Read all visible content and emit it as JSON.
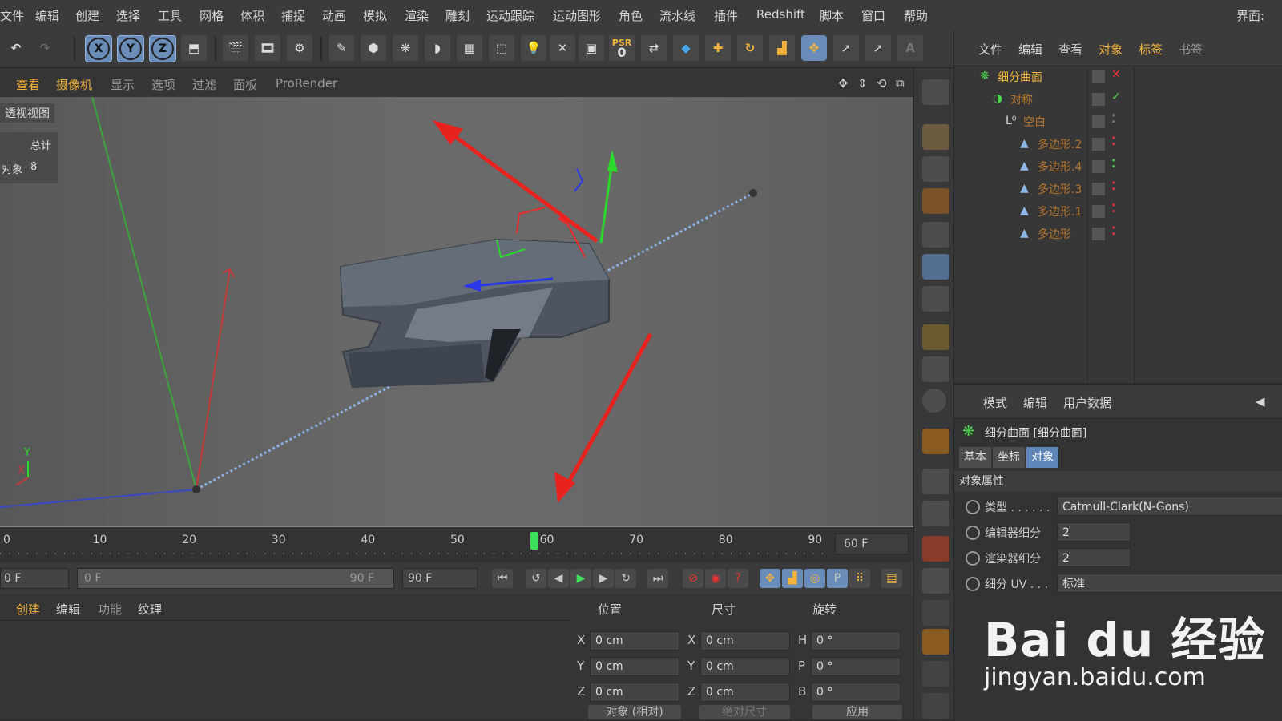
{
  "menubar": {
    "items": [
      "文件",
      "编辑",
      "创建",
      "选择",
      "工具",
      "网格",
      "体积",
      "捕捉",
      "动画",
      "模拟",
      "渲染",
      "雕刻",
      "运动跟踪",
      "运动图形",
      "角色",
      "流水线",
      "插件",
      "Redshift",
      "脚本",
      "窗口",
      "帮助"
    ],
    "right_label": "界面:"
  },
  "toolbar": {
    "axis_x": "X",
    "axis_y": "Y",
    "axis_z": "Z",
    "psr_label": "PSR",
    "psr_value": "0"
  },
  "viewport": {
    "menu": [
      "查看",
      "摄像机",
      "显示",
      "选项",
      "过滤",
      "面板",
      "ProRender"
    ],
    "title": "透视视图",
    "stats_header": "总计",
    "stats_label": "对象",
    "stats_value": "8",
    "axis_y_label": "Y",
    "axis_x_label": "X"
  },
  "object_manager": {
    "menu": [
      "文件",
      "编辑",
      "查看",
      "对象",
      "标签",
      "书签"
    ],
    "objects": [
      {
        "name": "细分曲面",
        "icon": "subdivision-icon",
        "status": "x"
      },
      {
        "name": "对称",
        "icon": "symmetry-icon",
        "status": "check"
      },
      {
        "name": "空白",
        "icon": "null-icon",
        "status": "none"
      },
      {
        "name": "多边形.2",
        "icon": "polygon-icon",
        "status": "red"
      },
      {
        "name": "多边形.4",
        "icon": "polygon-icon",
        "status": "green"
      },
      {
        "name": "多边形.3",
        "icon": "polygon-icon",
        "status": "red"
      },
      {
        "name": "多边形.1",
        "icon": "polygon-icon",
        "status": "red"
      },
      {
        "name": "多边形",
        "icon": "polygon-icon",
        "status": "red"
      }
    ]
  },
  "attribute_manager": {
    "menu": [
      "模式",
      "编辑",
      "用户数据"
    ],
    "object_title": "细分曲面 [细分曲面]",
    "tabs": [
      "基本",
      "坐标",
      "对象"
    ],
    "active_tab": "对象",
    "section": "对象属性",
    "props": [
      {
        "label": "类型 . . . . . .",
        "value": "Catmull-Clark(N-Gons)"
      },
      {
        "label": "编辑器细分",
        "value": "2"
      },
      {
        "label": "渲染器细分",
        "value": "2"
      },
      {
        "label": "细分 UV . . .",
        "value": "标准"
      }
    ]
  },
  "timeline": {
    "ticks": [
      "0",
      "10",
      "20",
      "30",
      "40",
      "50",
      "60",
      "70",
      "80",
      "90"
    ],
    "current_frame": 60,
    "end_field": "60 F"
  },
  "transport": {
    "start_field": "0 F",
    "range_start": "0 F",
    "range_end": "90 F",
    "end_field": "90 F"
  },
  "materials": {
    "menu": [
      "创建",
      "编辑",
      "功能",
      "纹理"
    ]
  },
  "coordinates": {
    "headers": [
      "位置",
      "尺寸",
      "旋转"
    ],
    "rows": [
      {
        "pl": "X",
        "pv": "0 cm",
        "sl": "X",
        "sv": "0 cm",
        "rl": "H",
        "rv": "0 °"
      },
      {
        "pl": "Y",
        "pv": "0 cm",
        "sl": "Y",
        "sv": "0 cm",
        "rl": "P",
        "rv": "0 °"
      },
      {
        "pl": "Z",
        "pv": "0 cm",
        "sl": "Z",
        "sv": "0 cm",
        "rl": "B",
        "rv": "0 °"
      }
    ],
    "mode_select": "对象 (相对)",
    "size_select": "绝对尺寸",
    "apply_button": "应用"
  },
  "watermark": {
    "logo": "Bai du 经验",
    "url": "jingyan.baidu.com"
  },
  "colors": {
    "accent_blue": "#6a8cb8",
    "object_orange": "#e59a3a",
    "arrow_red": "#e8231f"
  }
}
